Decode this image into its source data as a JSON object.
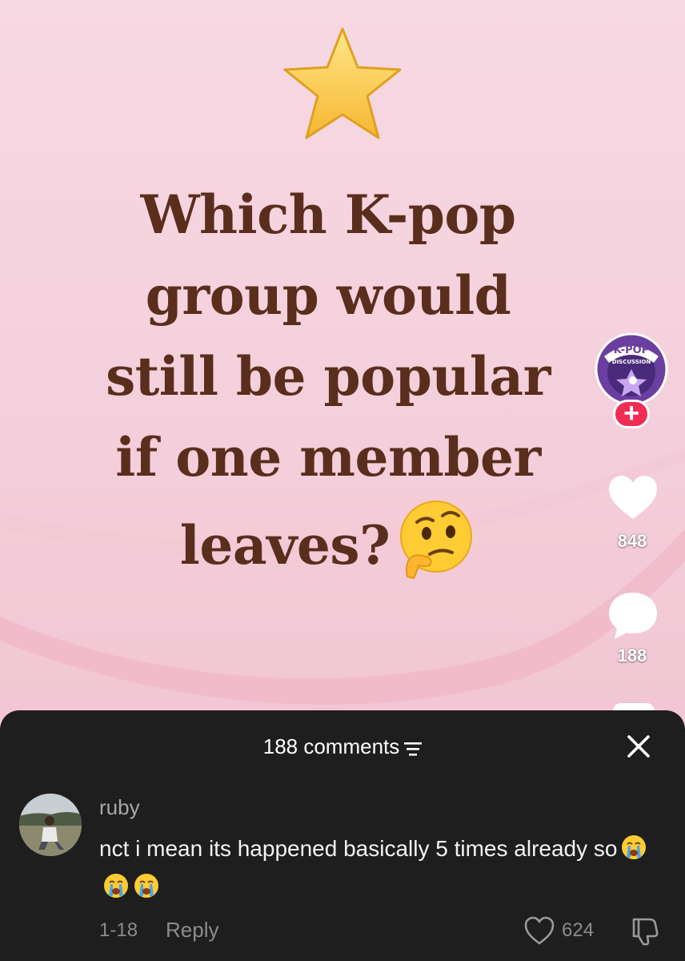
{
  "video": {
    "headline_lines": [
      "Which K-pop",
      "group would",
      "still be popular",
      "if one member",
      "leaves?"
    ],
    "top_emoji": "star-emoji",
    "end_emoji": "thinking-face-emoji"
  },
  "rail": {
    "badge_top_text": "K-POP",
    "badge_bottom_text": "DISCUSSION",
    "follow_label": "+",
    "likes": "848",
    "comments": "188"
  },
  "comments_sheet": {
    "title": "188 comments",
    "comment": {
      "username": "ruby",
      "text": "nct i mean its happened basically 5 times already so",
      "trailing_emojis": [
        "loudly-crying-face",
        "loudly-crying-face",
        "loudly-crying-face"
      ],
      "date": "1-18",
      "reply_label": "Reply",
      "likes": "624"
    }
  },
  "colors": {
    "background_pink": "#f6d6e0",
    "headline_brown": "#5a2e1d",
    "sheet_bg": "#1e1e1e",
    "follow_red": "#f02d55",
    "badge_purple": "#6b3fa0"
  }
}
